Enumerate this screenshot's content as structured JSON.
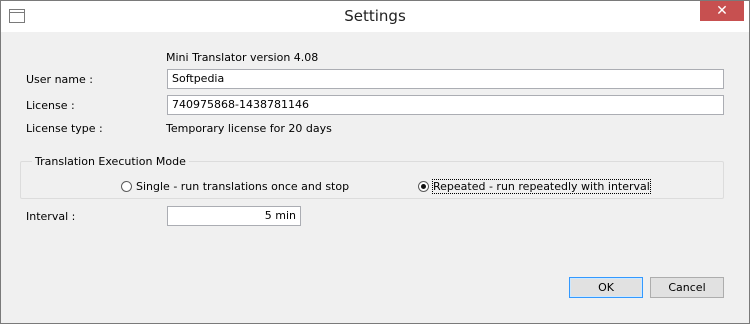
{
  "window": {
    "title": "Settings",
    "close_glyph": "✕"
  },
  "header": {
    "version": "Mini Translator version 4.08"
  },
  "form": {
    "user_name_label": "User name :",
    "user_name_value": "Softpedia",
    "license_label": "License :",
    "license_value": "740975868-1438781146",
    "license_type_label": "License type :",
    "license_type_value": "Temporary license for 20 days"
  },
  "mode": {
    "legend": "Translation Execution Mode",
    "single_label": "Single - run translations once and stop",
    "repeated_label": "Repeated - run repeatedly with interval",
    "selected": "repeated"
  },
  "interval": {
    "label": "Interval :",
    "value": "5 min"
  },
  "buttons": {
    "ok": "OK",
    "cancel": "Cancel"
  },
  "colors": {
    "close_button": "#c75050",
    "default_button_border": "#3399ff"
  }
}
